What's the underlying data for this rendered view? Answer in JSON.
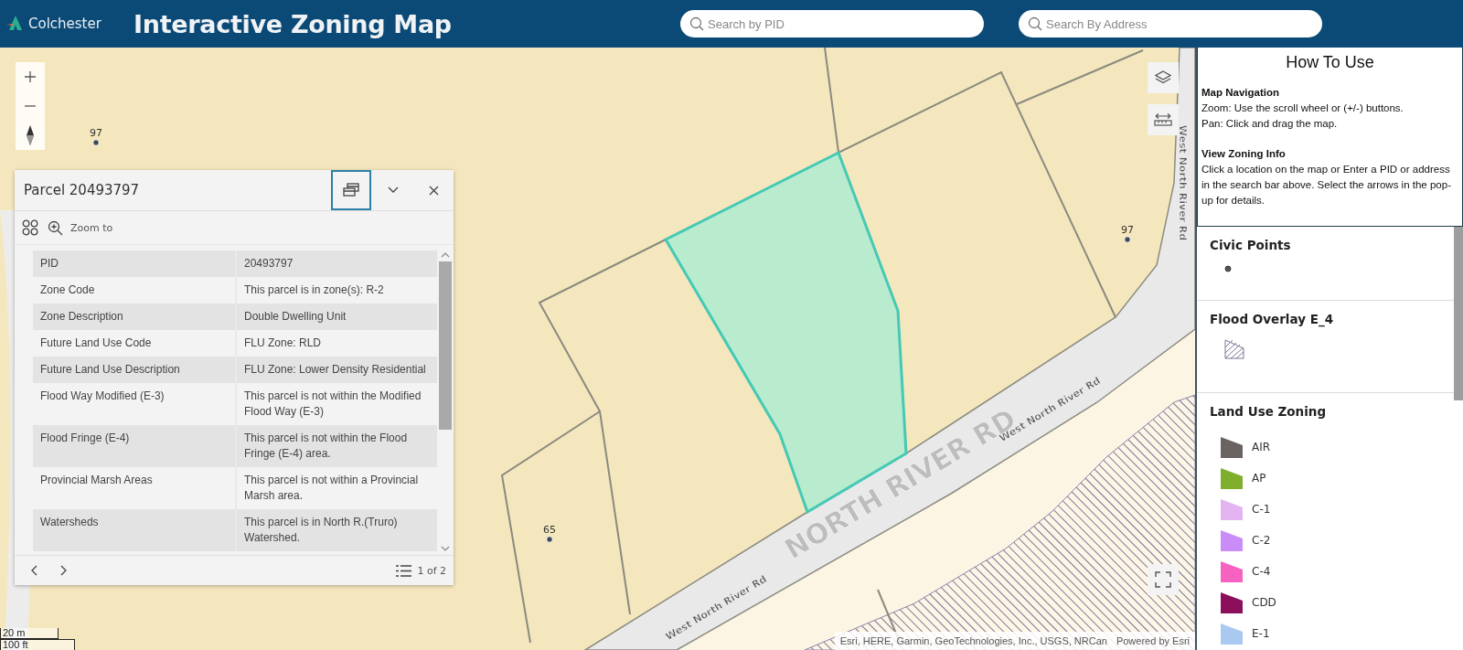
{
  "header": {
    "logo": "Colchester",
    "title": "Interactive Zoning Map",
    "search_fields": [
      {
        "placeholder": "Search by PID"
      },
      {
        "placeholder": "Search By Address"
      }
    ]
  },
  "map": {
    "civic_points": [
      {
        "label": "97"
      },
      {
        "label": "97"
      },
      {
        "label": "65"
      }
    ],
    "road_labels": [
      {
        "text": "West North River Rd"
      },
      {
        "text": "West North River Rd"
      },
      {
        "text": "West North River Rd"
      },
      {
        "text": "NORTH RIVER RD"
      }
    ],
    "scale_bar": {
      "metric": "20 m",
      "imperial": "100 ft"
    },
    "attribution": "Esri, HERE, Garmin, GeoTechnologies, Inc., USGS, NRCan",
    "powered_by": "Powered by Esri"
  },
  "popup": {
    "title": "Parcel 20493797",
    "zoom_action": "Zoom to",
    "rows": [
      {
        "label": "PID",
        "value": "20493797"
      },
      {
        "label": "Zone Code",
        "value": "This parcel is in zone(s): R-2"
      },
      {
        "label": "Zone Description",
        "value": "Double Dwelling Unit"
      },
      {
        "label": "Future Land Use Code",
        "value": "FLU Zone: RLD"
      },
      {
        "label": "Future Land Use Description",
        "value": "FLU Zone: Lower Density Residential"
      },
      {
        "label": "Flood Way Modified (E-3)",
        "value": "This parcel is not within the Modified Flood Way (E-3)"
      },
      {
        "label": "Flood Fringe (E-4)",
        "value": "This parcel is not within the Flood Fringe (E-4) area."
      },
      {
        "label": "Provincial Marsh Areas",
        "value": "This parcel is not within a Provincial Marsh area."
      },
      {
        "label": "Watersheds",
        "value": "This parcel is in North R.(Truro) Watershed."
      }
    ],
    "pager": "1 of 2"
  },
  "help": {
    "title": "How To Use",
    "sections": [
      {
        "heading": "Map Navigation",
        "lines": [
          "Zoom: Use the scroll wheel or (+/-) buttons.",
          "Pan: Click and drag the map."
        ]
      },
      {
        "heading": "View Zoning Info",
        "lines": [
          "Click a location on the map or Enter a PID or address in the search bar above. Select the arrows in the pop-up for details."
        ]
      }
    ]
  },
  "legend": {
    "sections": [
      {
        "title": "Civic Points",
        "kind": "point"
      },
      {
        "title": "Flood Overlay E_4",
        "kind": "hatch"
      },
      {
        "title": "Land Use Zoning",
        "kind": "classes",
        "items": [
          {
            "label": "AIR",
            "color": "#6b6262"
          },
          {
            "label": "AP",
            "color": "#7fae2f"
          },
          {
            "label": "C-1",
            "color": "#e3b3f2"
          },
          {
            "label": "C-2",
            "color": "#c98cf8"
          },
          {
            "label": "C-4",
            "color": "#f562c0"
          },
          {
            "label": "CDD",
            "color": "#8c0f5c"
          },
          {
            "label": "E-1",
            "color": "#a9c9f1"
          }
        ]
      }
    ]
  }
}
